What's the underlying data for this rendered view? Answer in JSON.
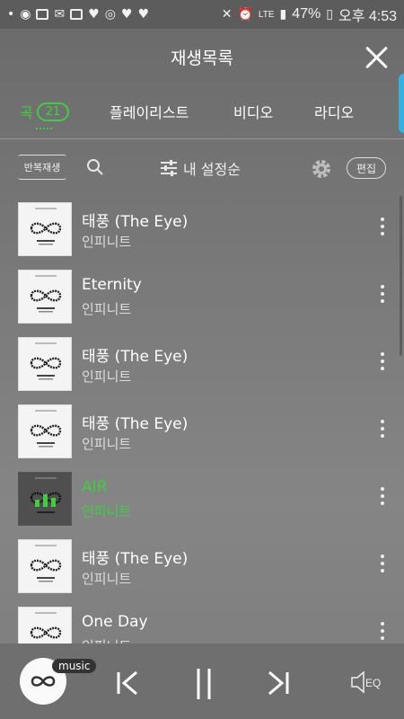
{
  "status_bar": {
    "battery": "47%",
    "time": "오후 4:53",
    "network": "LTE"
  },
  "header": {
    "title": "재생목록"
  },
  "tabs": {
    "songs_label": "곡",
    "songs_count": "21",
    "playlist_label": "플레이리스트",
    "video_label": "비디오",
    "radio_label": "라디오"
  },
  "toolbar": {
    "repeat_label": "반복재생",
    "sort_label": "내 설정순",
    "edit_label": "편집"
  },
  "tracks": [
    {
      "title": "태풍 (The Eye)",
      "artist": "인피니트",
      "active": false
    },
    {
      "title": "Eternity",
      "artist": "인피니트",
      "active": false
    },
    {
      "title": "태풍 (The Eye)",
      "artist": "인피니트",
      "active": false
    },
    {
      "title": "태풍 (The Eye)",
      "artist": "인피니트",
      "active": false
    },
    {
      "title": "AIR",
      "artist": "인피니트",
      "active": true
    },
    {
      "title": "태풍 (The Eye)",
      "artist": "인피니트",
      "active": false
    },
    {
      "title": "One Day",
      "artist": "인피니트",
      "active": false
    }
  ],
  "player": {
    "source_label": "music",
    "eq_label": "EQ"
  },
  "colors": {
    "accent": "#3ecf3e",
    "edge_handle": "#36b0e0"
  }
}
